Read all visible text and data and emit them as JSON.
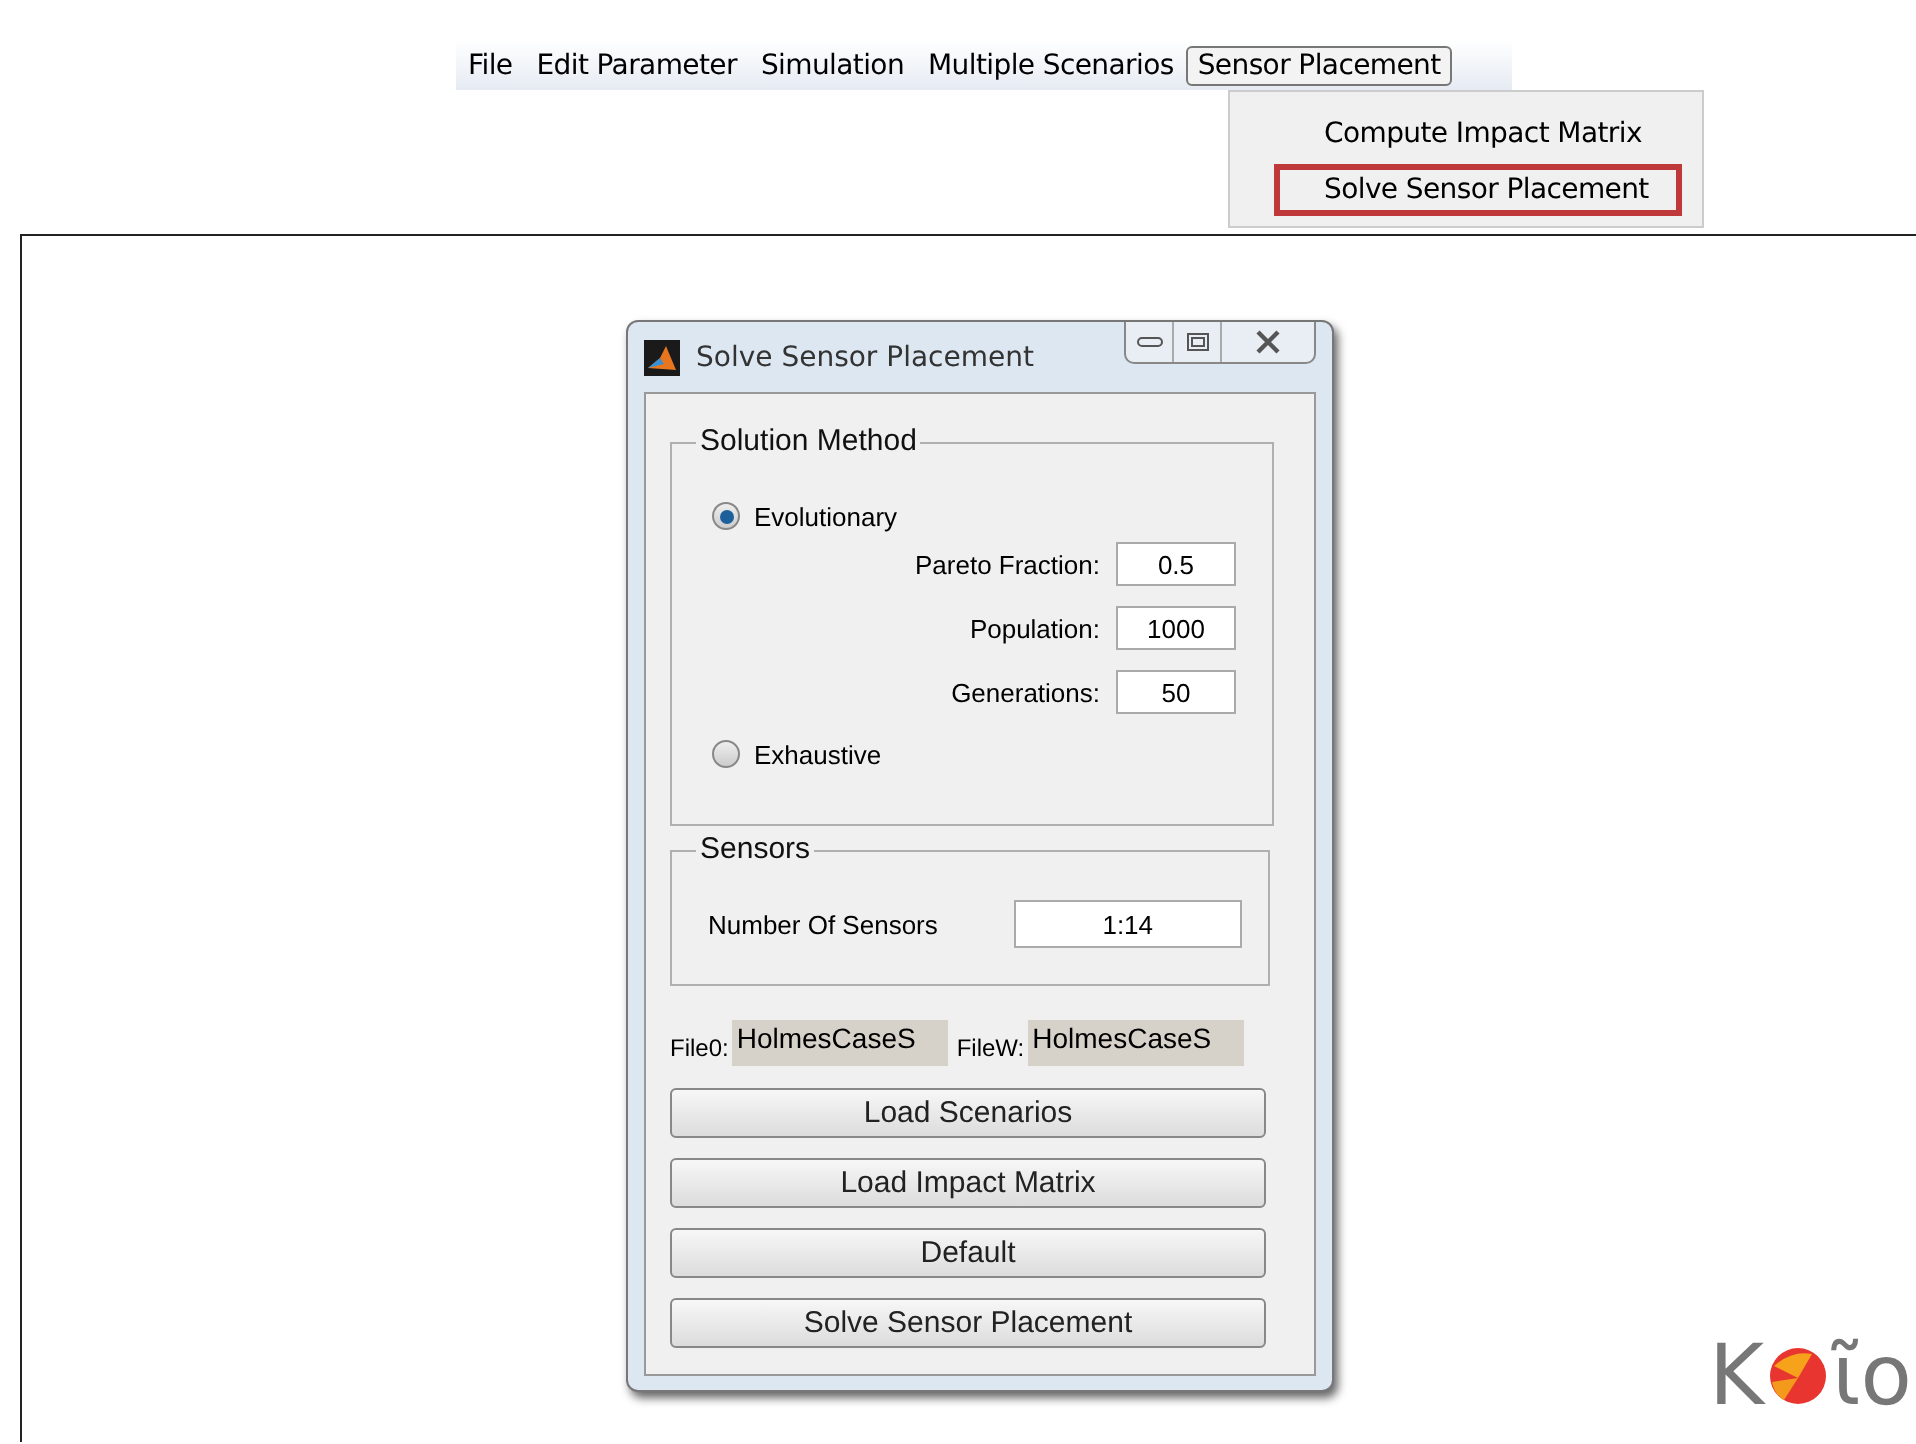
{
  "menu_bar": {
    "items": [
      {
        "label": "File",
        "selected": false
      },
      {
        "label": "Edit Parameter",
        "selected": false
      },
      {
        "label": "Simulation",
        "selected": false
      },
      {
        "label": "Multiple Scenarios",
        "selected": false
      },
      {
        "label": "Sensor Placement",
        "selected": true
      }
    ]
  },
  "dropdown": {
    "items": [
      {
        "label": "Compute Impact Matrix",
        "highlighted": false
      },
      {
        "label": "Solve Sensor Placement",
        "highlighted": true
      }
    ]
  },
  "dialog": {
    "title": "Solve Sensor Placement",
    "solution_method": {
      "title": "Solution Method",
      "options": [
        {
          "label": "Evolutionary",
          "selected": true,
          "fields": [
            {
              "label": "Pareto Fraction:",
              "value": "0.5"
            },
            {
              "label": "Population:",
              "value": "1000"
            },
            {
              "label": "Generations:",
              "value": "50"
            }
          ]
        },
        {
          "label": "Exhaustive",
          "selected": false
        }
      ]
    },
    "sensors": {
      "title": "Sensors",
      "label": "Number Of Sensors",
      "value": "1:14"
    },
    "files": [
      {
        "label": "File0:",
        "value": "HolmesCaseS"
      },
      {
        "label": "FileW:",
        "value": "HolmesCaseS"
      }
    ],
    "buttons": [
      "Load Scenarios",
      "Load Impact Matrix",
      "Default",
      "Solve Sensor Placement"
    ]
  },
  "logo": {
    "left": "K",
    "right": "ῖο"
  }
}
